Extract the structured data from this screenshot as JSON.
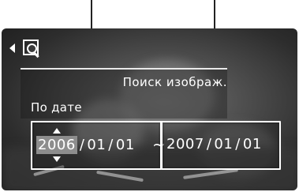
{
  "header": {
    "title": "Поиск изображ."
  },
  "search": {
    "mode_label": "По дате",
    "from": {
      "year": "2006",
      "month": "01",
      "day": "01"
    },
    "to": {
      "year": "2007",
      "month": "01",
      "day": "01"
    },
    "range_separator": "~"
  },
  "icons": {
    "back": "back-arrow-icon",
    "search": "image-search-icon"
  }
}
